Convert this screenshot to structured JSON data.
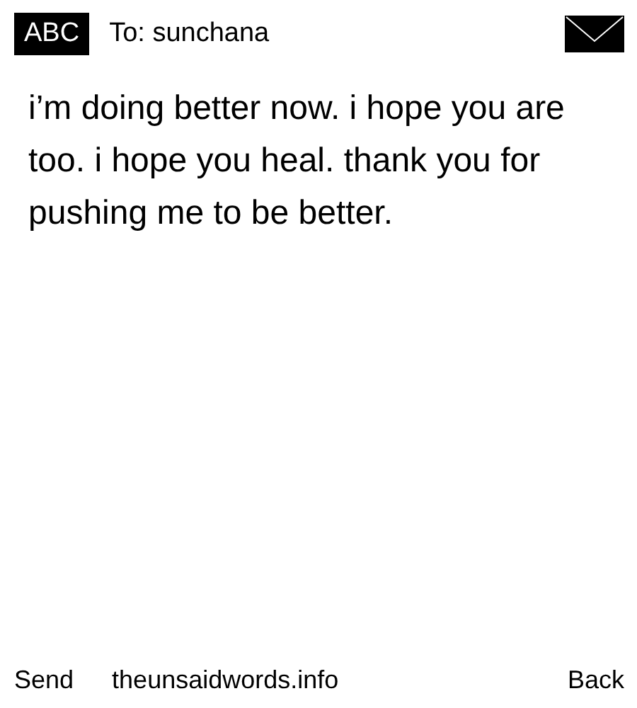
{
  "header": {
    "input_mode": "ABC",
    "recipient": "To: sunchana"
  },
  "message": "i’m doing better now. i hope you are too. i hope you heal. thank you for pushing me to be better.",
  "softkeys": {
    "left": "Send",
    "center": "theunsaidwords.info",
    "right": "Back"
  }
}
